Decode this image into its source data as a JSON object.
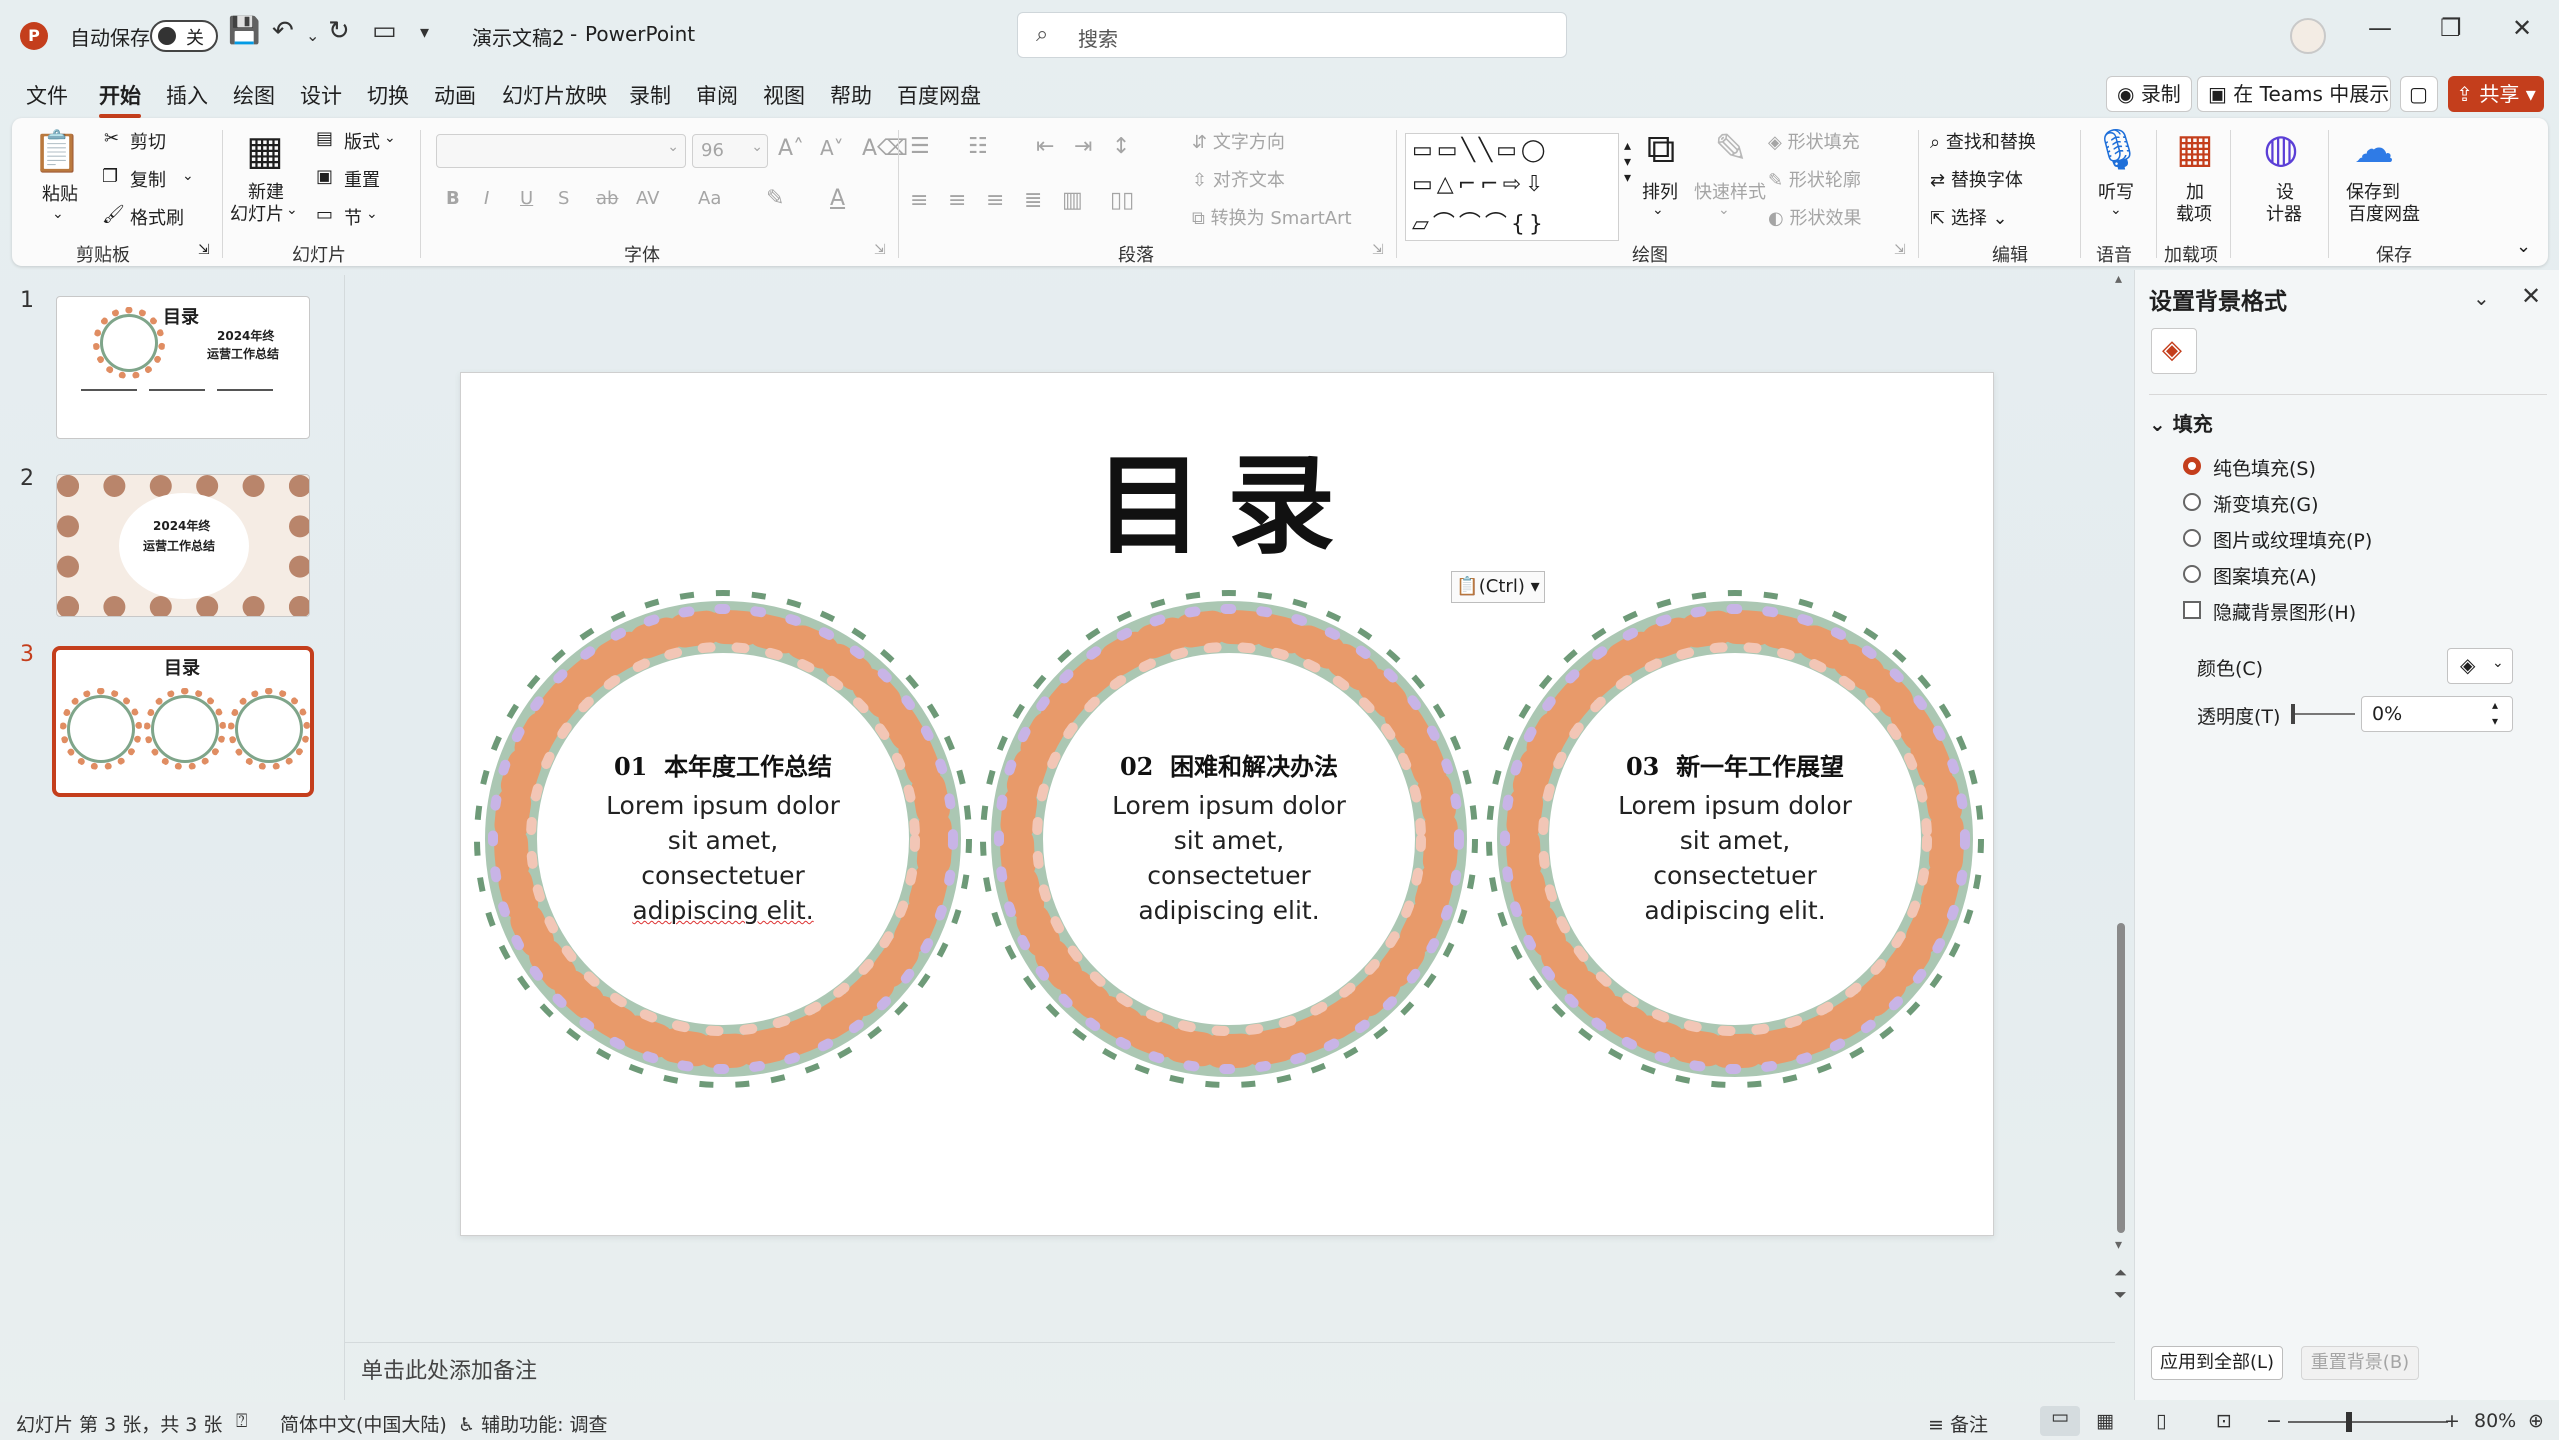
{
  "titlebar": {
    "autosave_label": "自动保存",
    "autosave_state": "关",
    "doc_title": "演示文稿2",
    "separator": "-",
    "app_name": "PowerPoint",
    "search_placeholder": "搜索"
  },
  "tabs": [
    "文件",
    "开始",
    "插入",
    "绘图",
    "设计",
    "切换",
    "动画",
    "幻灯片放映",
    "录制",
    "审阅",
    "视图",
    "帮助",
    "百度网盘"
  ],
  "active_tab": "开始",
  "top_actions": {
    "record": "录制",
    "teams": "在 Teams 中展示",
    "share": "共享"
  },
  "ribbon": {
    "clipboard": {
      "label": "剪贴板",
      "paste": "粘贴",
      "cut": "剪切",
      "copy": "复制",
      "format_painter": "格式刷"
    },
    "slides": {
      "label": "幻灯片",
      "new_slide_1": "新建",
      "new_slide_2": "幻灯片",
      "layout": "版式",
      "reset": "重置",
      "section": "节"
    },
    "font": {
      "label": "字体",
      "size": "96"
    },
    "paragraph": {
      "label": "段落",
      "text_direction": "文字方向",
      "align_text": "对齐文本",
      "smartart": "转换为 SmartArt"
    },
    "drawing": {
      "label": "绘图",
      "arrange": "排列",
      "quick_styles": "快速样式",
      "shape_fill": "形状填充",
      "shape_outline": "形状轮廓",
      "shape_effects": "形状效果"
    },
    "editing": {
      "label": "编辑",
      "find_replace": "查找和替换",
      "replace_font": "替换字体",
      "select": "选择"
    },
    "voice": {
      "label": "语音",
      "dictate": "听写"
    },
    "addins": {
      "label": "加载项",
      "addins_1": "加",
      "addins_2": "载项"
    },
    "designer": {
      "d1": "设",
      "d2": "计器"
    },
    "save": {
      "label": "保存",
      "save_1": "保存到",
      "save_2": "百度网盘"
    }
  },
  "thumbnails": [
    {
      "num": "1",
      "title": "目录",
      "sub1": "2024年终",
      "sub2": "运营工作总结"
    },
    {
      "num": "2",
      "sub1": "2024年终",
      "sub2": "运营工作总结"
    },
    {
      "num": "3",
      "title": "目录"
    }
  ],
  "slide": {
    "title": "目录",
    "paste_tag": "(Ctrl)",
    "items": [
      {
        "num": "01",
        "heading": "本年度工作总结",
        "body_lines": [
          "Lorem ipsum dolor",
          "sit amet,",
          "consectetuer",
          "adipiscing elit."
        ]
      },
      {
        "num": "02",
        "heading": "困难和解决办法",
        "body_lines": [
          "Lorem ipsum dolor",
          "sit amet,",
          "consectetuer",
          "adipiscing elit."
        ]
      },
      {
        "num": "03",
        "heading": "新一年工作展望",
        "body_lines": [
          "Lorem ipsum dolor",
          "sit amet,",
          "consectetuer",
          "adipiscing elit."
        ]
      }
    ]
  },
  "notes_placeholder": "单击此处添加备注",
  "pane": {
    "title": "设置背景格式",
    "section": "填充",
    "options": [
      "纯色填充(S)",
      "渐变填充(G)",
      "图片或纹理填充(P)",
      "图案填充(A)"
    ],
    "hide_bg": "隐藏背景图形(H)",
    "color_label": "颜色(C)",
    "transparency_label": "透明度(T)",
    "transparency_value": "0%",
    "apply_all": "应用到全部(L)",
    "reset_bg": "重置背景(B)"
  },
  "status": {
    "slide_info": "幻灯片 第 3 张，共 3 张",
    "language": "简体中文(中国大陆)",
    "accessibility": "辅助功能: 调查",
    "notes": "备注",
    "zoom": "80%"
  },
  "colors": {
    "accent": "#c43e1c"
  }
}
